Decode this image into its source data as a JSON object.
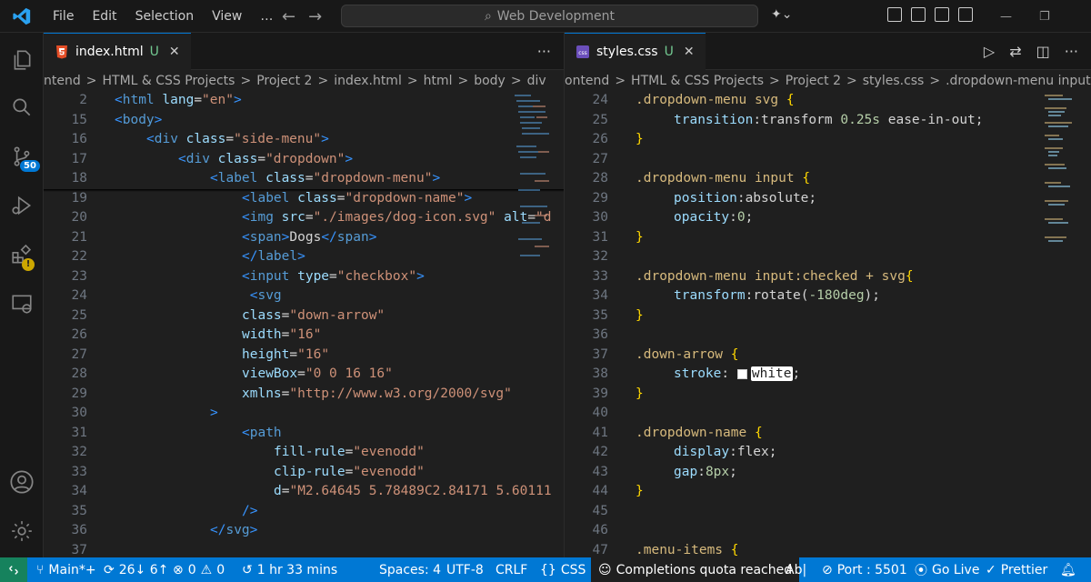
{
  "menu": [
    "File",
    "Edit",
    "Selection",
    "View",
    "…"
  ],
  "command_center": {
    "label": "Web Development"
  },
  "activity_badges": {
    "source_control": "50"
  },
  "left_editor": {
    "tab": {
      "name": "index.html",
      "status": "U"
    },
    "breadcrumb": [
      "ntend",
      "HTML & CSS Projects",
      "Project 2",
      "index.html",
      "html",
      "body",
      "div"
    ],
    "lines": [
      {
        "n": "2",
        "indent": 0,
        "parts": [
          [
            "t-tag",
            "<"
          ],
          [
            "t-name",
            "html"
          ],
          [
            "t-attr",
            " lang"
          ],
          [
            "t-pun",
            "="
          ],
          [
            "t-str",
            "\"en\""
          ],
          [
            "t-tag",
            ">"
          ]
        ]
      },
      {
        "n": "15",
        "indent": 0,
        "parts": [
          [
            "t-tag",
            "<"
          ],
          [
            "t-name",
            "body"
          ],
          [
            "t-tag",
            ">"
          ]
        ]
      },
      {
        "n": "16",
        "indent": 1,
        "parts": [
          [
            "t-tag",
            "<"
          ],
          [
            "t-name",
            "div"
          ],
          [
            "t-attr",
            " class"
          ],
          [
            "t-pun",
            "="
          ],
          [
            "t-str",
            "\"side-menu\""
          ],
          [
            "t-tag",
            ">"
          ]
        ]
      },
      {
        "n": "17",
        "indent": 2,
        "parts": [
          [
            "t-tag",
            "<"
          ],
          [
            "t-name",
            "div"
          ],
          [
            "t-attr",
            " class"
          ],
          [
            "t-pun",
            "="
          ],
          [
            "t-str",
            "\"dropdown\""
          ],
          [
            "t-tag",
            ">"
          ]
        ]
      },
      {
        "n": "18",
        "indent": 3,
        "parts": [
          [
            "t-tag",
            "<"
          ],
          [
            "t-name",
            "label"
          ],
          [
            "t-attr",
            " class"
          ],
          [
            "t-pun",
            "="
          ],
          [
            "t-str",
            "\"dropdown-menu\""
          ],
          [
            "t-tag",
            ">"
          ]
        ]
      },
      {
        "n": "19",
        "indent": 4,
        "parts": [
          [
            "t-tag",
            "<"
          ],
          [
            "t-name",
            "label"
          ],
          [
            "t-attr",
            " class"
          ],
          [
            "t-pun",
            "="
          ],
          [
            "t-str",
            "\"dropdown-name\""
          ],
          [
            "t-tag",
            ">"
          ]
        ]
      },
      {
        "n": "20",
        "indent": 4,
        "parts": [
          [
            "t-tag",
            "<"
          ],
          [
            "t-name",
            "img"
          ],
          [
            "t-attr",
            " src"
          ],
          [
            "t-pun",
            "="
          ],
          [
            "t-str",
            "\"./images/dog-icon.svg\""
          ],
          [
            "t-attr",
            " alt"
          ],
          [
            "t-pun",
            "="
          ],
          [
            "t-str",
            "\"d"
          ]
        ]
      },
      {
        "n": "21",
        "indent": 4,
        "parts": [
          [
            "t-tag",
            "<"
          ],
          [
            "t-name",
            "span"
          ],
          [
            "t-tag",
            ">"
          ],
          [
            "t-txt",
            "Dogs"
          ],
          [
            "t-tag",
            "</"
          ],
          [
            "t-name",
            "span"
          ],
          [
            "t-tag",
            ">"
          ]
        ]
      },
      {
        "n": "22",
        "indent": 4,
        "parts": [
          [
            "t-tag",
            "</"
          ],
          [
            "t-name",
            "label"
          ],
          [
            "t-tag",
            ">"
          ]
        ]
      },
      {
        "n": "23",
        "indent": 4,
        "parts": [
          [
            "t-tag",
            "<"
          ],
          [
            "t-name",
            "input"
          ],
          [
            "t-attr",
            " type"
          ],
          [
            "t-pun",
            "="
          ],
          [
            "t-str",
            "\"checkbox\""
          ],
          [
            "t-tag",
            ">"
          ]
        ]
      },
      {
        "n": "24",
        "indent": 4,
        "parts": [
          [
            "t-tag",
            " <"
          ],
          [
            "t-name",
            "svg"
          ]
        ]
      },
      {
        "n": "25",
        "indent": 4,
        "parts": [
          [
            "t-attr",
            "class"
          ],
          [
            "t-pun",
            "="
          ],
          [
            "t-str",
            "\"down-arrow\""
          ]
        ]
      },
      {
        "n": "26",
        "indent": 4,
        "parts": [
          [
            "t-attr",
            "width"
          ],
          [
            "t-pun",
            "="
          ],
          [
            "t-str",
            "\"16\""
          ]
        ]
      },
      {
        "n": "27",
        "indent": 4,
        "parts": [
          [
            "t-attr",
            "height"
          ],
          [
            "t-pun",
            "="
          ],
          [
            "t-str",
            "\"16\""
          ]
        ]
      },
      {
        "n": "28",
        "indent": 4,
        "parts": [
          [
            "t-attr",
            "viewBox"
          ],
          [
            "t-pun",
            "="
          ],
          [
            "t-str",
            "\"0 0 16 16\""
          ]
        ]
      },
      {
        "n": "29",
        "indent": 4,
        "parts": [
          [
            "t-attr",
            "xmlns"
          ],
          [
            "t-pun",
            "="
          ],
          [
            "t-str",
            "\"http://www.w3.org/2000/svg\""
          ]
        ]
      },
      {
        "n": "30",
        "indent": 3,
        "parts": [
          [
            "t-tag",
            ">"
          ]
        ]
      },
      {
        "n": "31",
        "indent": 4,
        "parts": [
          [
            "t-tag",
            "<"
          ],
          [
            "t-name",
            "path"
          ]
        ]
      },
      {
        "n": "32",
        "indent": 5,
        "parts": [
          [
            "t-attr",
            "fill-rule"
          ],
          [
            "t-pun",
            "="
          ],
          [
            "t-str",
            "\"evenodd\""
          ]
        ]
      },
      {
        "n": "33",
        "indent": 5,
        "parts": [
          [
            "t-attr",
            "clip-rule"
          ],
          [
            "t-pun",
            "="
          ],
          [
            "t-str",
            "\"evenodd\""
          ]
        ]
      },
      {
        "n": "34",
        "indent": 5,
        "parts": [
          [
            "t-attr",
            "d"
          ],
          [
            "t-pun",
            "="
          ],
          [
            "t-str",
            "\"M2.64645 5.78489C2.84171 5.60111"
          ]
        ]
      },
      {
        "n": "35",
        "indent": 4,
        "parts": [
          [
            "t-tag",
            "/>"
          ]
        ]
      },
      {
        "n": "36",
        "indent": 3,
        "parts": [
          [
            "t-tag",
            "</"
          ],
          [
            "t-name",
            "svg"
          ],
          [
            "t-tag",
            ">"
          ]
        ]
      },
      {
        "n": "37",
        "indent": 0,
        "parts": []
      }
    ]
  },
  "right_editor": {
    "tab": {
      "name": "styles.css",
      "status": "U"
    },
    "breadcrumb": [
      "ontend",
      "HTML & CSS Projects",
      "Project 2",
      "styles.css",
      ".dropdown-menu input:c"
    ],
    "lines": [
      {
        "n": "24",
        "indent": 0,
        "parts": [
          [
            "t-sel",
            ".dropdown-menu svg "
          ],
          [
            "t-br",
            "{"
          ]
        ]
      },
      {
        "n": "25",
        "indent": 1,
        "parts": [
          [
            "t-prop",
            "transition"
          ],
          [
            "t-pun",
            ":"
          ],
          [
            "t-txt",
            "transform "
          ],
          [
            "t-num",
            "0.25s"
          ],
          [
            "t-txt",
            " ease-in-out"
          ],
          [
            "t-pun",
            ";"
          ]
        ]
      },
      {
        "n": "26",
        "indent": 0,
        "parts": [
          [
            "t-br",
            "}"
          ]
        ]
      },
      {
        "n": "27",
        "indent": 0,
        "parts": []
      },
      {
        "n": "28",
        "indent": 0,
        "parts": [
          [
            "t-sel",
            ".dropdown-menu input "
          ],
          [
            "t-br",
            "{"
          ]
        ]
      },
      {
        "n": "29",
        "indent": 1,
        "parts": [
          [
            "t-prop",
            "position"
          ],
          [
            "t-pun",
            ":"
          ],
          [
            "t-txt",
            "absolute"
          ],
          [
            "t-pun",
            ";"
          ]
        ]
      },
      {
        "n": "30",
        "indent": 1,
        "parts": [
          [
            "t-prop",
            "opacity"
          ],
          [
            "t-pun",
            ":"
          ],
          [
            "t-num",
            "0"
          ],
          [
            "t-pun",
            ";"
          ]
        ]
      },
      {
        "n": "31",
        "indent": 0,
        "parts": [
          [
            "t-br",
            "}"
          ]
        ]
      },
      {
        "n": "32",
        "indent": 0,
        "parts": []
      },
      {
        "n": "33",
        "indent": 0,
        "parts": [
          [
            "t-sel",
            ".dropdown-menu input:checked + svg"
          ],
          [
            "t-br",
            "{"
          ]
        ]
      },
      {
        "n": "34",
        "indent": 1,
        "parts": [
          [
            "t-prop",
            "transform"
          ],
          [
            "t-pun",
            ":"
          ],
          [
            "t-txt",
            "rotate"
          ],
          [
            "t-pun",
            "("
          ],
          [
            "t-num",
            "-180deg"
          ],
          [
            "t-pun",
            ");"
          ]
        ]
      },
      {
        "n": "35",
        "indent": 0,
        "parts": [
          [
            "t-br",
            "}"
          ]
        ]
      },
      {
        "n": "36",
        "indent": 0,
        "parts": []
      },
      {
        "n": "37",
        "indent": 0,
        "parts": [
          [
            "t-sel",
            ".down-arrow "
          ],
          [
            "t-br",
            "{"
          ]
        ]
      },
      {
        "n": "38",
        "indent": 1,
        "parts": [
          [
            "t-prop",
            "stroke"
          ],
          [
            "t-pun",
            ": "
          ],
          [
            "swatch",
            ""
          ],
          [
            "hl",
            "white"
          ],
          [
            "t-pun",
            ";"
          ]
        ]
      },
      {
        "n": "39",
        "indent": 0,
        "parts": [
          [
            "t-br",
            "}"
          ]
        ]
      },
      {
        "n": "40",
        "indent": 0,
        "parts": []
      },
      {
        "n": "41",
        "indent": 0,
        "parts": [
          [
            "t-sel",
            ".dropdown-name "
          ],
          [
            "t-br",
            "{"
          ]
        ]
      },
      {
        "n": "42",
        "indent": 1,
        "parts": [
          [
            "t-prop",
            "display"
          ],
          [
            "t-pun",
            ":"
          ],
          [
            "t-txt",
            "flex"
          ],
          [
            "t-pun",
            ";"
          ]
        ]
      },
      {
        "n": "43",
        "indent": 1,
        "parts": [
          [
            "t-prop",
            "gap"
          ],
          [
            "t-pun",
            ":"
          ],
          [
            "t-num",
            "8px"
          ],
          [
            "t-pun",
            ";"
          ]
        ]
      },
      {
        "n": "44",
        "indent": 0,
        "parts": [
          [
            "t-br",
            "}"
          ]
        ]
      },
      {
        "n": "45",
        "indent": 0,
        "parts": []
      },
      {
        "n": "46",
        "indent": 0,
        "parts": []
      },
      {
        "n": "47",
        "indent": 0,
        "parts": [
          [
            "t-sel",
            ".menu-items "
          ],
          [
            "t-br",
            "{"
          ]
        ]
      }
    ]
  },
  "statusbar": {
    "branch": "Main*+",
    "sync": "26↓ 6↑",
    "errors": "0",
    "warnings": "0",
    "time": "1 hr 33 mins",
    "spaces": "Spaces: 4",
    "encoding": "UTF-8",
    "eol": "CRLF",
    "language": "CSS",
    "copilot": "Completions quota reached",
    "abl": "Ab|",
    "port": "Port : 5501",
    "golive": "Go Live",
    "prettier": "Prettier"
  },
  "colors": {
    "accent": "#0078d4",
    "statusbar": "#0078d4",
    "untracked": "#73c991"
  }
}
